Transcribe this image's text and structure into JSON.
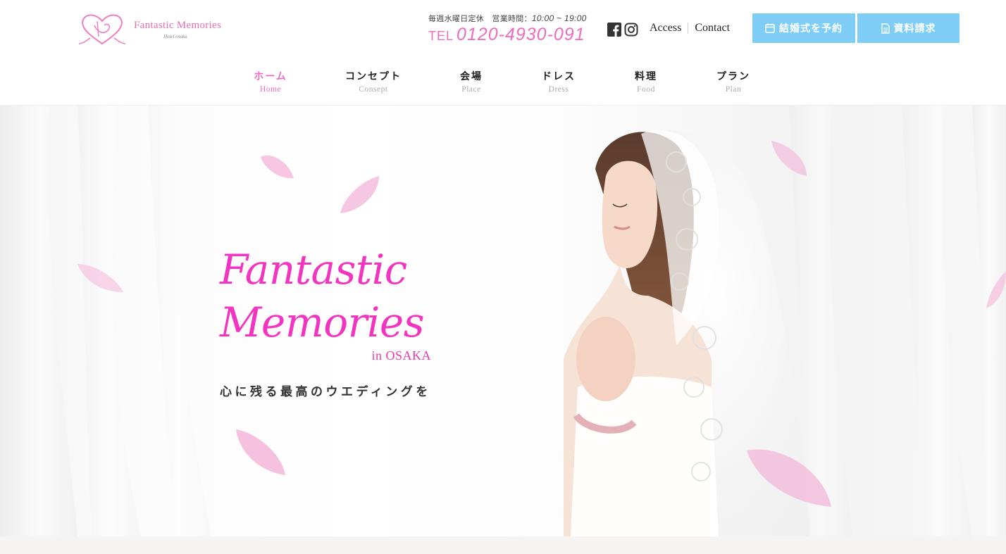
{
  "brand": {
    "name": "Fantastic Memories",
    "sub": "Hotel osaka"
  },
  "header": {
    "hours_label": "毎週水曜日定休　営業時間：",
    "hours_time": "10:00 ~ 19:00",
    "tel_label": "TEL",
    "tel_number": "0120-4930-091",
    "social": [
      {
        "icon": "facebook-icon"
      },
      {
        "icon": "instagram-icon"
      }
    ],
    "links": [
      "Access",
      "Contact"
    ],
    "reserve_button": "結婚式を予約",
    "docs_button": "資料請求",
    "accent_color": "#f06bbf",
    "button_color": "#7dcdf7"
  },
  "nav": [
    {
      "jp": "ホーム",
      "en": "Home",
      "active": true
    },
    {
      "jp": "コンセプト",
      "en": "Consept",
      "active": false
    },
    {
      "jp": "会場",
      "en": "Place",
      "active": false
    },
    {
      "jp": "ドレス",
      "en": "Dress",
      "active": false
    },
    {
      "jp": "料理",
      "en": "Food",
      "active": false
    },
    {
      "jp": "プラン",
      "en": "Plan",
      "active": false
    }
  ],
  "hero": {
    "title_line1": "Fantastic",
    "title_line2": "Memories",
    "location": "in OSAKA",
    "catchphrase": "心に残る最高のウエディングを",
    "title_color": "#f235c0"
  }
}
